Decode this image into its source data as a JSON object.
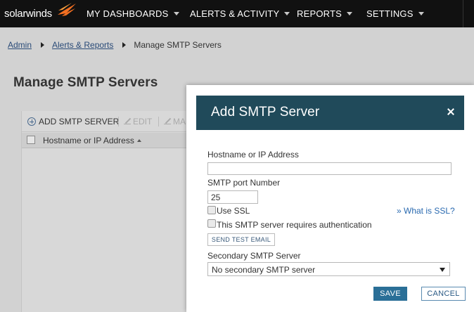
{
  "app": {
    "logo_text": "solarwinds",
    "brand_color": "#f36f21"
  },
  "nav": {
    "items": [
      {
        "label": "MY DASHBOARDS"
      },
      {
        "label": "ALERTS & ACTIVITY"
      },
      {
        "label": "REPORTS"
      },
      {
        "label": "SETTINGS"
      }
    ]
  },
  "breadcrumb": {
    "items": [
      {
        "label": "Admin"
      },
      {
        "label": "Alerts & Reports"
      },
      {
        "label": "Manage SMTP Servers"
      }
    ]
  },
  "page": {
    "title": "Manage SMTP Servers"
  },
  "grid": {
    "toolbar": {
      "add_label": "ADD SMTP SERVER",
      "edit_label": "EDIT",
      "more_label": "MA"
    },
    "columns": [
      {
        "label": "Hostname or IP Address"
      }
    ]
  },
  "dialog": {
    "title": "Add SMTP Server",
    "header_color": "#204a5a",
    "hostname": {
      "label": "Hostname or IP Address",
      "value": ""
    },
    "port": {
      "label": "SMTP port Number",
      "value": "25"
    },
    "use_ssl": {
      "label": "Use SSL",
      "checked": false
    },
    "ssl_link": "» What is SSL?",
    "auth": {
      "label": "This SMTP server requires authentication",
      "checked": false
    },
    "test_button_label": "SEND TEST EMAIL",
    "secondary": {
      "label": "Secondary SMTP Server",
      "selected": "No secondary SMTP server"
    },
    "save_label": "SAVE",
    "cancel_label": "CANCEL"
  }
}
